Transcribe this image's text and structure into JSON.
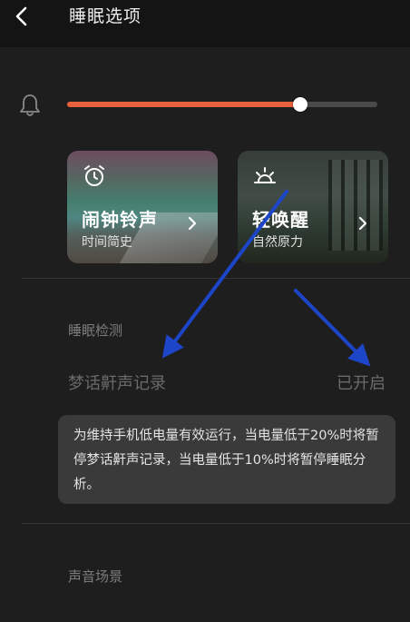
{
  "header": {
    "title": "睡眠选项",
    "back_icon": "chevron-left-icon"
  },
  "volume": {
    "icon": "bell-icon",
    "level_percent": 75,
    "fill_color": "#e8603c"
  },
  "cards": [
    {
      "title": "闹钟铃声",
      "subtitle": "时间简史",
      "icon": "alarm-clock-icon"
    },
    {
      "title": "轻唤醒",
      "subtitle": "自然原力",
      "icon": "sunrise-icon"
    }
  ],
  "sleep_detection": {
    "section_label": "睡眠检测",
    "setting_label": "梦话鼾声记录",
    "setting_value": "已开启",
    "notice": "为维持手机低电量有效运行，当电量低于20%时将暂停梦话鼾声记录，当电量低于10%时将暂停睡眠分析。"
  },
  "sound_scene": {
    "section_label": "声音场景"
  },
  "annotation": {
    "arrow_color": "#1d45c8"
  }
}
